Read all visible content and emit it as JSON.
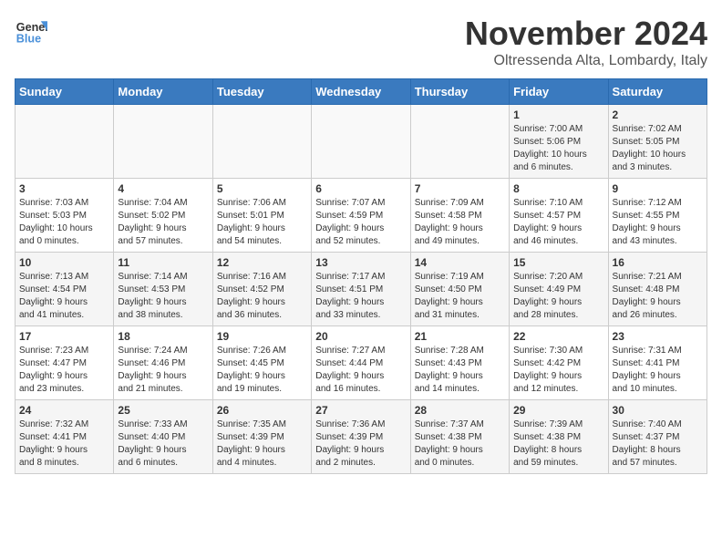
{
  "header": {
    "logo_line1": "General",
    "logo_line2": "Blue",
    "month": "November 2024",
    "location": "Oltressenda Alta, Lombardy, Italy"
  },
  "days_of_week": [
    "Sunday",
    "Monday",
    "Tuesday",
    "Wednesday",
    "Thursday",
    "Friday",
    "Saturday"
  ],
  "weeks": [
    [
      {
        "day": "",
        "info": ""
      },
      {
        "day": "",
        "info": ""
      },
      {
        "day": "",
        "info": ""
      },
      {
        "day": "",
        "info": ""
      },
      {
        "day": "",
        "info": ""
      },
      {
        "day": "1",
        "info": "Sunrise: 7:00 AM\nSunset: 5:06 PM\nDaylight: 10 hours\nand 6 minutes."
      },
      {
        "day": "2",
        "info": "Sunrise: 7:02 AM\nSunset: 5:05 PM\nDaylight: 10 hours\nand 3 minutes."
      }
    ],
    [
      {
        "day": "3",
        "info": "Sunrise: 7:03 AM\nSunset: 5:03 PM\nDaylight: 10 hours\nand 0 minutes."
      },
      {
        "day": "4",
        "info": "Sunrise: 7:04 AM\nSunset: 5:02 PM\nDaylight: 9 hours\nand 57 minutes."
      },
      {
        "day": "5",
        "info": "Sunrise: 7:06 AM\nSunset: 5:01 PM\nDaylight: 9 hours\nand 54 minutes."
      },
      {
        "day": "6",
        "info": "Sunrise: 7:07 AM\nSunset: 4:59 PM\nDaylight: 9 hours\nand 52 minutes."
      },
      {
        "day": "7",
        "info": "Sunrise: 7:09 AM\nSunset: 4:58 PM\nDaylight: 9 hours\nand 49 minutes."
      },
      {
        "day": "8",
        "info": "Sunrise: 7:10 AM\nSunset: 4:57 PM\nDaylight: 9 hours\nand 46 minutes."
      },
      {
        "day": "9",
        "info": "Sunrise: 7:12 AM\nSunset: 4:55 PM\nDaylight: 9 hours\nand 43 minutes."
      }
    ],
    [
      {
        "day": "10",
        "info": "Sunrise: 7:13 AM\nSunset: 4:54 PM\nDaylight: 9 hours\nand 41 minutes."
      },
      {
        "day": "11",
        "info": "Sunrise: 7:14 AM\nSunset: 4:53 PM\nDaylight: 9 hours\nand 38 minutes."
      },
      {
        "day": "12",
        "info": "Sunrise: 7:16 AM\nSunset: 4:52 PM\nDaylight: 9 hours\nand 36 minutes."
      },
      {
        "day": "13",
        "info": "Sunrise: 7:17 AM\nSunset: 4:51 PM\nDaylight: 9 hours\nand 33 minutes."
      },
      {
        "day": "14",
        "info": "Sunrise: 7:19 AM\nSunset: 4:50 PM\nDaylight: 9 hours\nand 31 minutes."
      },
      {
        "day": "15",
        "info": "Sunrise: 7:20 AM\nSunset: 4:49 PM\nDaylight: 9 hours\nand 28 minutes."
      },
      {
        "day": "16",
        "info": "Sunrise: 7:21 AM\nSunset: 4:48 PM\nDaylight: 9 hours\nand 26 minutes."
      }
    ],
    [
      {
        "day": "17",
        "info": "Sunrise: 7:23 AM\nSunset: 4:47 PM\nDaylight: 9 hours\nand 23 minutes."
      },
      {
        "day": "18",
        "info": "Sunrise: 7:24 AM\nSunset: 4:46 PM\nDaylight: 9 hours\nand 21 minutes."
      },
      {
        "day": "19",
        "info": "Sunrise: 7:26 AM\nSunset: 4:45 PM\nDaylight: 9 hours\nand 19 minutes."
      },
      {
        "day": "20",
        "info": "Sunrise: 7:27 AM\nSunset: 4:44 PM\nDaylight: 9 hours\nand 16 minutes."
      },
      {
        "day": "21",
        "info": "Sunrise: 7:28 AM\nSunset: 4:43 PM\nDaylight: 9 hours\nand 14 minutes."
      },
      {
        "day": "22",
        "info": "Sunrise: 7:30 AM\nSunset: 4:42 PM\nDaylight: 9 hours\nand 12 minutes."
      },
      {
        "day": "23",
        "info": "Sunrise: 7:31 AM\nSunset: 4:41 PM\nDaylight: 9 hours\nand 10 minutes."
      }
    ],
    [
      {
        "day": "24",
        "info": "Sunrise: 7:32 AM\nSunset: 4:41 PM\nDaylight: 9 hours\nand 8 minutes."
      },
      {
        "day": "25",
        "info": "Sunrise: 7:33 AM\nSunset: 4:40 PM\nDaylight: 9 hours\nand 6 minutes."
      },
      {
        "day": "26",
        "info": "Sunrise: 7:35 AM\nSunset: 4:39 PM\nDaylight: 9 hours\nand 4 minutes."
      },
      {
        "day": "27",
        "info": "Sunrise: 7:36 AM\nSunset: 4:39 PM\nDaylight: 9 hours\nand 2 minutes."
      },
      {
        "day": "28",
        "info": "Sunrise: 7:37 AM\nSunset: 4:38 PM\nDaylight: 9 hours\nand 0 minutes."
      },
      {
        "day": "29",
        "info": "Sunrise: 7:39 AM\nSunset: 4:38 PM\nDaylight: 8 hours\nand 59 minutes."
      },
      {
        "day": "30",
        "info": "Sunrise: 7:40 AM\nSunset: 4:37 PM\nDaylight: 8 hours\nand 57 minutes."
      }
    ]
  ]
}
